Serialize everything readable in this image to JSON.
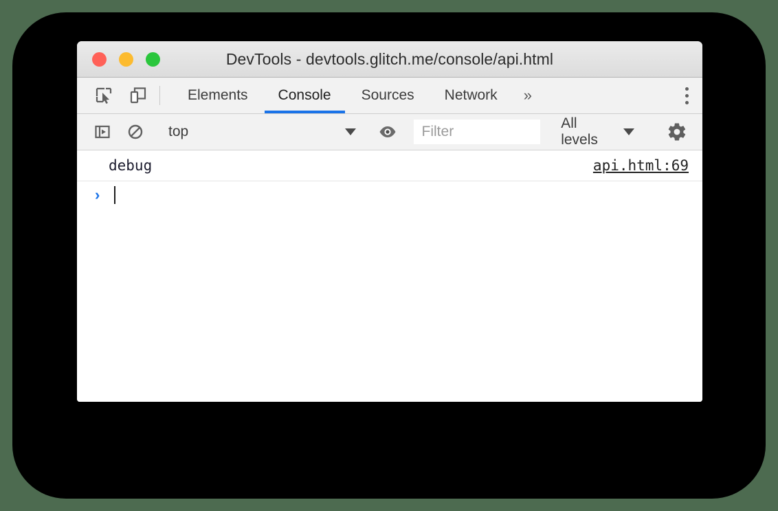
{
  "window": {
    "title": "DevTools - devtools.glitch.me/console/api.html",
    "traffic_lights": [
      {
        "name": "close",
        "color": "#ff6158"
      },
      {
        "name": "minimize",
        "color": "#fcbb2f"
      },
      {
        "name": "maximize",
        "color": "#2ac63c"
      }
    ]
  },
  "tabbar": {
    "inspect_icon": "inspect-element-icon",
    "device_icon": "device-toolbar-icon",
    "tabs": [
      {
        "label": "Elements",
        "active": false
      },
      {
        "label": "Console",
        "active": true
      },
      {
        "label": "Sources",
        "active": false
      },
      {
        "label": "Network",
        "active": false
      }
    ],
    "more_tabs_label": "»",
    "menu_icon": "kebab-menu-icon",
    "active_underline_color": "#1a73e8"
  },
  "filterbar": {
    "sidebar_icon": "console-sidebar-icon",
    "clear_icon": "clear-console-icon",
    "context": {
      "value": "top",
      "caret": "chevron-down-icon"
    },
    "live_expression_icon": "eye-icon",
    "filter": {
      "placeholder": "Filter",
      "value": ""
    },
    "levels": {
      "label": "All levels",
      "caret": "chevron-down-icon"
    },
    "settings_icon": "gear-icon"
  },
  "console": {
    "messages": [
      {
        "text": "debug",
        "source": "api.html:69"
      }
    ],
    "prompt": {
      "arrow": "›",
      "value": ""
    }
  },
  "colors": {
    "page_background": "#4d6b50",
    "backdrop": "#000000",
    "window_background": "#ffffff",
    "toolbar_background": "#f2f2f2",
    "accent": "#1a73e8"
  }
}
